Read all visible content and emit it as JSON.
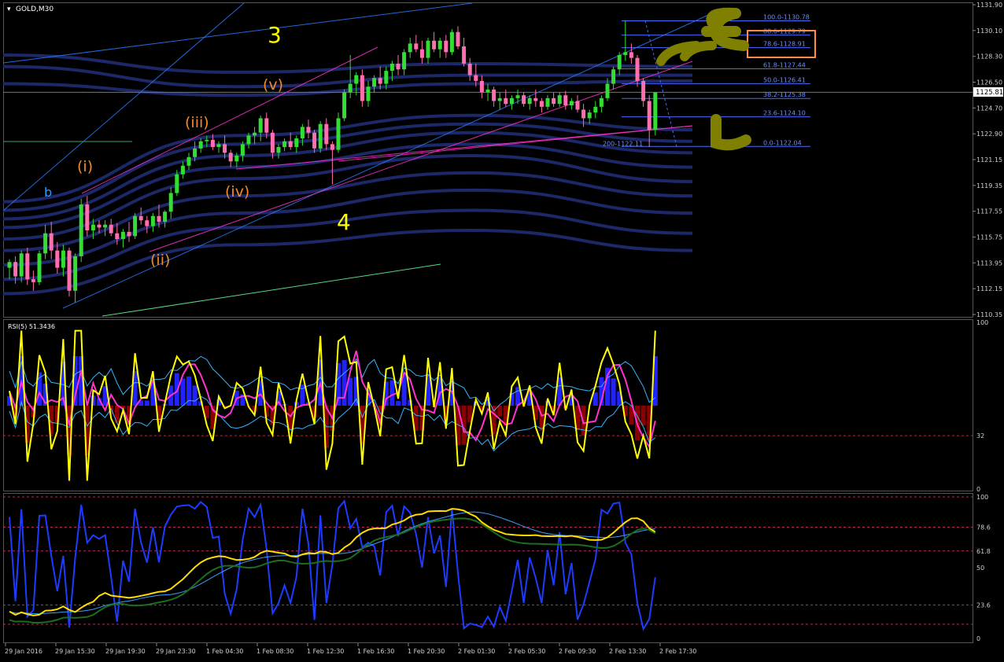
{
  "window": {
    "symbol_title": "GOLD,M30"
  },
  "colors": {
    "background": "#000000",
    "grid": "#2a2a2a",
    "bull_candle": "#33dd33",
    "bear_candle": "#ff6fae",
    "axis_text": "#cfcfcf",
    "fib_line": "#4a6cff",
    "fib_text": "#6f8cff",
    "current_price_box": "#ffffff",
    "wave_major": "#ffff00",
    "wave_minor": "#f08a2c",
    "wave_b": "#2b9cff",
    "rsi_yellow": "#ffff00",
    "rsi_magenta": "#ff33cc",
    "rsi_cyan": "#33b5ff",
    "hist_blue": "#2222ff",
    "hist_red": "#8b0000",
    "ribbon": "#1e2a6e",
    "highlight_box": "#ff8c42",
    "olive_marks": "#808000"
  },
  "price_axis": {
    "ticks": [
      "1131.90",
      "1130.10",
      "1128.30",
      "1126.50",
      "1124.70",
      "1122.90",
      "1121.15",
      "1119.35",
      "1117.55",
      "1115.75",
      "1113.95",
      "1112.15",
      "1110.35"
    ],
    "current_price": "1125.81"
  },
  "time_axis": {
    "ticks": [
      "29 Jan 2016",
      "29 Jan 15:30",
      "29 Jan 19:30",
      "29 Jan 23:30",
      "1 Feb 04:30",
      "1 Feb 08:30",
      "1 Feb 12:30",
      "1 Feb 16:30",
      "1 Feb 20:30",
      "2 Feb 01:30",
      "2 Feb 05:30",
      "2 Feb 09:30",
      "2 Feb 13:30",
      "2 Feb 17:30"
    ]
  },
  "fibonacci": {
    "levels": [
      "100.0-1130.78",
      "88.6-1129.79",
      "78.6-1128.91",
      "61.8-1127.44",
      "50.0-1126.41",
      "38.2-1125.38",
      "23.6-1124.10",
      "0.0-1122.04"
    ],
    "extra_label": "200-1122.11"
  },
  "wave_labels": {
    "major_3": "3",
    "major_4": "4",
    "minor_i": "(i)",
    "minor_ii": "(ii)",
    "minor_iii": "(iii)",
    "minor_iv": "(iv)",
    "minor_v": "(v)",
    "b": "b"
  },
  "rsi_panel": {
    "title": "RSI(5) 51.3436",
    "levels": [
      "100",
      "32",
      "0"
    ]
  },
  "stoch_panel": {
    "levels": [
      "100",
      "78.6",
      "61.8",
      "50",
      "23.6",
      "0"
    ]
  },
  "chart_data": {
    "type": "candlestick",
    "symbol": "GOLD",
    "timeframe": "M30",
    "ylim": [
      1110.35,
      1131.9
    ],
    "candles": [
      [
        1113.6,
        1114.2,
        1112.8,
        1114.0
      ],
      [
        1114.0,
        1114.4,
        1112.5,
        1113.0
      ],
      [
        1113.0,
        1114.8,
        1112.6,
        1114.6
      ],
      [
        1114.6,
        1115.0,
        1112.4,
        1112.8
      ],
      [
        1112.8,
        1113.4,
        1112.0,
        1112.6
      ],
      [
        1112.6,
        1114.8,
        1112.4,
        1114.6
      ],
      [
        1114.6,
        1116.6,
        1114.2,
        1116.0
      ],
      [
        1116.0,
        1116.8,
        1114.2,
        1114.8
      ],
      [
        1114.8,
        1115.4,
        1113.2,
        1113.6
      ],
      [
        1113.6,
        1115.2,
        1113.0,
        1114.8
      ],
      [
        1114.8,
        1115.0,
        1111.6,
        1112.0
      ],
      [
        1112.0,
        1114.6,
        1111.2,
        1114.4
      ],
      [
        1114.4,
        1118.4,
        1114.0,
        1118.0
      ],
      [
        1118.0,
        1118.6,
        1115.8,
        1116.2
      ],
      [
        1116.2,
        1117.0,
        1115.6,
        1116.6
      ],
      [
        1116.6,
        1116.9,
        1116.0,
        1116.4
      ],
      [
        1116.4,
        1116.9,
        1115.8,
        1116.6
      ],
      [
        1116.6,
        1117.0,
        1115.8,
        1116.0
      ],
      [
        1116.0,
        1116.7,
        1115.2,
        1115.6
      ],
      [
        1115.6,
        1116.3,
        1115.0,
        1116.1
      ],
      [
        1116.1,
        1116.8,
        1115.4,
        1115.8
      ],
      [
        1115.8,
        1117.4,
        1115.6,
        1117.2
      ],
      [
        1117.2,
        1117.8,
        1116.6,
        1116.9
      ],
      [
        1116.9,
        1117.2,
        1116.0,
        1116.5
      ],
      [
        1116.5,
        1117.4,
        1116.1,
        1117.2
      ],
      [
        1117.2,
        1118.0,
        1116.4,
        1116.8
      ],
      [
        1116.8,
        1117.6,
        1116.4,
        1117.5
      ],
      [
        1117.5,
        1119.2,
        1117.0,
        1118.8
      ],
      [
        1118.8,
        1120.4,
        1118.6,
        1120.1
      ],
      [
        1120.1,
        1121.0,
        1119.8,
        1120.7
      ],
      [
        1120.7,
        1121.6,
        1120.4,
        1121.3
      ],
      [
        1121.3,
        1122.4,
        1121.0,
        1121.9
      ],
      [
        1121.9,
        1122.6,
        1121.6,
        1122.4
      ],
      [
        1122.4,
        1122.8,
        1122.0,
        1122.5
      ],
      [
        1122.5,
        1122.9,
        1121.8,
        1122.0
      ],
      [
        1122.0,
        1122.4,
        1121.6,
        1122.2
      ],
      [
        1122.2,
        1122.8,
        1121.2,
        1121.6
      ],
      [
        1121.6,
        1121.8,
        1120.6,
        1121.0
      ],
      [
        1121.0,
        1121.6,
        1120.6,
        1121.4
      ],
      [
        1121.4,
        1122.4,
        1121.0,
        1122.2
      ],
      [
        1122.2,
        1123.0,
        1121.9,
        1122.8
      ],
      [
        1122.8,
        1123.4,
        1122.2,
        1123.0
      ],
      [
        1123.0,
        1124.2,
        1122.4,
        1124.0
      ],
      [
        1124.0,
        1124.4,
        1122.6,
        1123.0
      ],
      [
        1123.0,
        1123.2,
        1121.2,
        1121.6
      ],
      [
        1121.6,
        1122.2,
        1121.2,
        1122.0
      ],
      [
        1122.0,
        1122.6,
        1121.7,
        1122.4
      ],
      [
        1122.4,
        1123.0,
        1121.8,
        1122.0
      ],
      [
        1122.0,
        1122.8,
        1121.6,
        1122.6
      ],
      [
        1122.6,
        1123.6,
        1122.1,
        1123.4
      ],
      [
        1123.4,
        1123.9,
        1122.6,
        1123.0
      ],
      [
        1123.0,
        1123.2,
        1121.6,
        1121.9
      ],
      [
        1121.9,
        1123.8,
        1121.6,
        1123.6
      ],
      [
        1123.6,
        1124.0,
        1121.8,
        1122.2
      ],
      [
        1122.2,
        1122.4,
        1119.4,
        1121.8
      ],
      [
        1121.8,
        1124.4,
        1121.6,
        1124.0
      ],
      [
        1124.0,
        1126.0,
        1123.8,
        1125.8
      ],
      [
        1125.8,
        1128.4,
        1125.4,
        1126.4
      ],
      [
        1126.4,
        1127.2,
        1125.6,
        1127.0
      ],
      [
        1127.0,
        1127.4,
        1124.8,
        1125.2
      ],
      [
        1125.2,
        1126.6,
        1124.8,
        1126.2
      ],
      [
        1126.2,
        1127.0,
        1125.8,
        1126.8
      ],
      [
        1126.8,
        1127.6,
        1126.0,
        1126.4
      ],
      [
        1126.4,
        1127.6,
        1126.0,
        1127.3
      ],
      [
        1127.3,
        1128.0,
        1126.6,
        1127.8
      ],
      [
        1127.8,
        1128.4,
        1127.0,
        1127.4
      ],
      [
        1127.4,
        1128.8,
        1127.0,
        1128.6
      ],
      [
        1128.6,
        1129.6,
        1128.2,
        1129.2
      ],
      [
        1129.2,
        1129.8,
        1128.6,
        1128.8
      ],
      [
        1128.8,
        1129.4,
        1127.8,
        1128.2
      ],
      [
        1128.2,
        1129.6,
        1127.8,
        1129.4
      ],
      [
        1129.4,
        1130.0,
        1128.6,
        1128.8
      ],
      [
        1128.8,
        1129.6,
        1128.2,
        1129.4
      ],
      [
        1129.4,
        1129.8,
        1128.2,
        1128.6
      ],
      [
        1128.6,
        1130.2,
        1128.4,
        1130.0
      ],
      [
        1130.0,
        1130.4,
        1128.8,
        1129.0
      ],
      [
        1129.0,
        1129.6,
        1127.6,
        1127.8
      ],
      [
        1127.8,
        1128.2,
        1126.6,
        1127.0
      ],
      [
        1127.0,
        1127.8,
        1126.2,
        1126.6
      ],
      [
        1126.6,
        1127.0,
        1125.4,
        1125.8
      ],
      [
        1125.8,
        1126.4,
        1125.2,
        1126.0
      ],
      [
        1126.0,
        1126.2,
        1124.8,
        1125.2
      ],
      [
        1125.2,
        1125.8,
        1124.6,
        1125.4
      ],
      [
        1125.4,
        1126.0,
        1124.8,
        1125.0
      ],
      [
        1125.0,
        1125.6,
        1124.6,
        1125.4
      ],
      [
        1125.4,
        1126.0,
        1125.0,
        1125.6
      ],
      [
        1125.6,
        1125.8,
        1124.8,
        1125.0
      ],
      [
        1125.0,
        1125.6,
        1124.6,
        1125.4
      ],
      [
        1125.4,
        1126.0,
        1124.8,
        1125.2
      ],
      [
        1125.2,
        1125.4,
        1124.4,
        1124.8
      ],
      [
        1124.8,
        1125.6,
        1124.6,
        1125.4
      ],
      [
        1125.4,
        1125.8,
        1124.8,
        1125.0
      ],
      [
        1125.0,
        1125.8,
        1124.8,
        1125.6
      ],
      [
        1125.6,
        1125.9,
        1124.6,
        1124.9
      ],
      [
        1124.9,
        1125.4,
        1124.6,
        1125.2
      ],
      [
        1125.2,
        1125.6,
        1124.4,
        1124.6
      ],
      [
        1124.6,
        1125.0,
        1123.4,
        1124.0
      ],
      [
        1124.0,
        1124.6,
        1123.6,
        1124.4
      ],
      [
        1124.4,
        1125.2,
        1124.0,
        1124.8
      ],
      [
        1124.8,
        1125.6,
        1124.4,
        1125.4
      ],
      [
        1125.4,
        1126.8,
        1125.2,
        1126.4
      ],
      [
        1126.4,
        1127.6,
        1126.0,
        1127.4
      ],
      [
        1127.4,
        1128.6,
        1127.0,
        1128.4
      ],
      [
        1128.4,
        1130.8,
        1128.0,
        1128.6
      ],
      [
        1128.6,
        1129.2,
        1127.8,
        1128.2
      ],
      [
        1128.2,
        1128.4,
        1126.2,
        1126.6
      ],
      [
        1126.6,
        1126.8,
        1124.8,
        1125.2
      ],
      [
        1125.2,
        1125.6,
        1122.0,
        1123.2
      ],
      [
        1123.2,
        1125.8,
        1122.8,
        1125.8
      ]
    ]
  }
}
